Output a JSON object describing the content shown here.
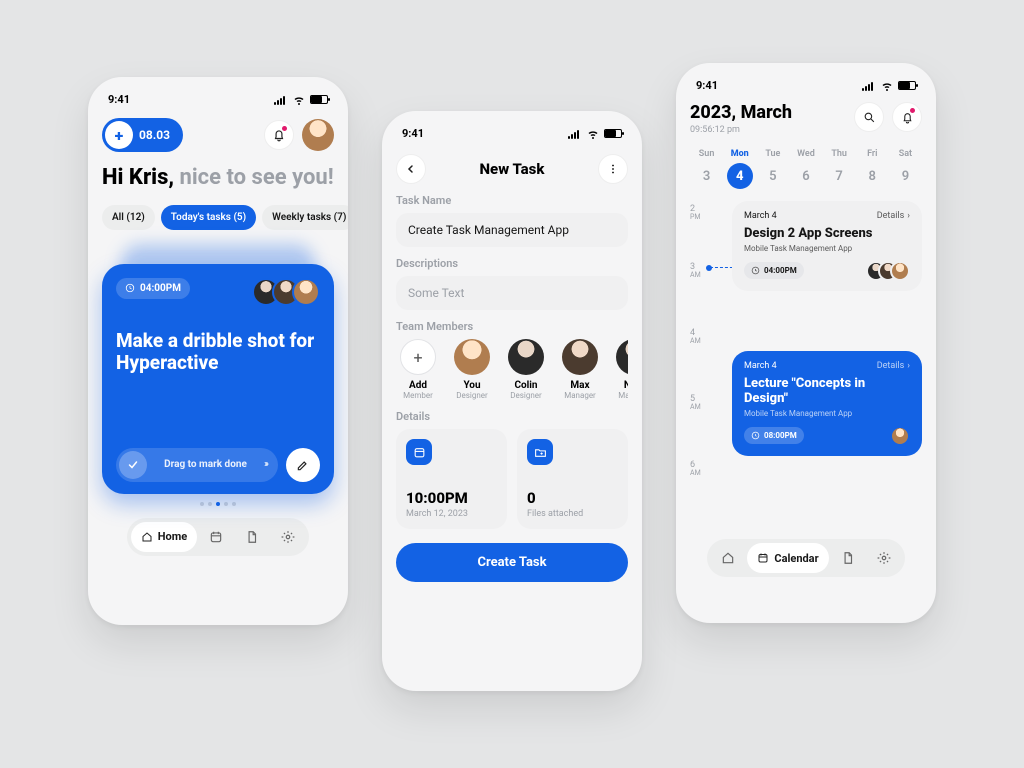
{
  "status_time": "9:41",
  "screen1": {
    "date_pill": "08.03",
    "greeting_bold": "Hi Kris,",
    "greeting_rest": " nice to see you!",
    "chips": [
      {
        "label": "All",
        "count": "(12)"
      },
      {
        "label": "Today's tasks",
        "count": "(5)"
      },
      {
        "label": "Weekly tasks",
        "count": "(7)"
      }
    ],
    "card": {
      "time": "04:00PM",
      "title": "Make a dribble shot for Hyperactive",
      "swipe_label": "Drag to mark done"
    },
    "tabs": {
      "home": "Home"
    }
  },
  "screen2": {
    "title": "New Task",
    "labels": {
      "name": "Task Name",
      "desc": "Descriptions",
      "team": "Team Members",
      "details": "Details"
    },
    "task_name": "Create Task Management App",
    "desc_placeholder": "Some Text",
    "members": [
      {
        "name": "Add",
        "role": "Member",
        "add": true
      },
      {
        "name": "You",
        "role": "Designer"
      },
      {
        "name": "Colin",
        "role": "Designer"
      },
      {
        "name": "Max",
        "role": "Manager"
      },
      {
        "name": "Nick",
        "role": "Manager"
      }
    ],
    "detail_time": {
      "big": "10:00PM",
      "sub": "March 12, 2023"
    },
    "detail_files": {
      "big": "0",
      "sub": "Files attached"
    },
    "cta": "Create Task"
  },
  "screen3": {
    "month": "2023, March",
    "clock": "09:56:12 pm",
    "week": [
      {
        "dn": "Sun",
        "num": "3"
      },
      {
        "dn": "Mon",
        "num": "4",
        "on": true
      },
      {
        "dn": "Tue",
        "num": "5"
      },
      {
        "dn": "Wed",
        "num": "6"
      },
      {
        "dn": "Thu",
        "num": "7"
      },
      {
        "dn": "Fri",
        "num": "8"
      },
      {
        "dn": "Sat",
        "num": "9"
      }
    ],
    "hours": [
      "2 PM",
      "3 AM",
      "4 AM",
      "5 AM",
      "6 AM"
    ],
    "events": [
      {
        "date": "March 4",
        "details": "Details",
        "title": "Design 2 App Screens",
        "sub": "Mobile Task Management App",
        "time": "04:00PM",
        "style": "white"
      },
      {
        "date": "March 4",
        "details": "Details",
        "title": "Lecture \"Concepts in Design\"",
        "sub": "Mobile Task Management App",
        "time": "08:00PM",
        "style": "blue"
      }
    ],
    "tabs": {
      "calendar": "Calendar"
    }
  }
}
